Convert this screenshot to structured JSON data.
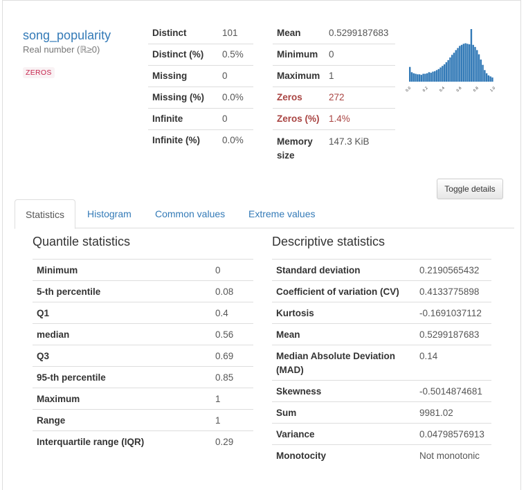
{
  "variable": {
    "name": "song_popularity",
    "type": "Real number (ℝ≥0)",
    "badge": "ZEROS"
  },
  "overview_left": [
    {
      "label": "Distinct",
      "value": "101"
    },
    {
      "label": "Distinct (%)",
      "value": "0.5%"
    },
    {
      "label": "Missing",
      "value": "0"
    },
    {
      "label": "Missing (%)",
      "value": "0.0%"
    },
    {
      "label": "Infinite",
      "value": "0"
    },
    {
      "label": "Infinite (%)",
      "value": "0.0%"
    }
  ],
  "overview_right": [
    {
      "label": "Mean",
      "value": "0.5299187683"
    },
    {
      "label": "Minimum",
      "value": "0"
    },
    {
      "label": "Maximum",
      "value": "1"
    },
    {
      "label": "Zeros",
      "value": "272"
    },
    {
      "label": "Zeros (%)",
      "value": "1.4%"
    },
    {
      "label": "Memory size",
      "value": "147.3 KiB"
    }
  ],
  "histogram": {
    "tick_labels": [
      "0.0",
      "0.2",
      "0.4",
      "0.6",
      "0.8",
      "1.0"
    ],
    "bar_color": "#337ab7",
    "relative_heights": [
      0.28,
      0.18,
      0.16,
      0.15,
      0.14,
      0.14,
      0.13,
      0.15,
      0.15,
      0.16,
      0.18,
      0.17,
      0.19,
      0.2,
      0.22,
      0.24,
      0.27,
      0.3,
      0.33,
      0.37,
      0.41,
      0.46,
      0.51,
      0.55,
      0.6,
      0.64,
      0.68,
      0.7,
      0.72,
      0.73,
      0.72,
      0.71,
      1.0,
      0.7,
      0.66,
      0.6,
      0.52,
      0.42,
      0.32,
      0.22,
      0.16,
      0.12,
      0.1,
      0.08
    ]
  },
  "toggle_button": "Toggle details",
  "tabs": [
    "Statistics",
    "Histogram",
    "Common values",
    "Extreme values"
  ],
  "quantile": {
    "title": "Quantile statistics",
    "rows": [
      {
        "label": "Minimum",
        "value": "0"
      },
      {
        "label": "5-th percentile",
        "value": "0.08"
      },
      {
        "label": "Q1",
        "value": "0.4"
      },
      {
        "label": "median",
        "value": "0.56"
      },
      {
        "label": "Q3",
        "value": "0.69"
      },
      {
        "label": "95-th percentile",
        "value": "0.85"
      },
      {
        "label": "Maximum",
        "value": "1"
      },
      {
        "label": "Range",
        "value": "1"
      },
      {
        "label": "Interquartile range (IQR)",
        "value": "0.29"
      }
    ]
  },
  "descriptive": {
    "title": "Descriptive statistics",
    "rows": [
      {
        "label": "Standard deviation",
        "value": "0.2190565432"
      },
      {
        "label": "Coefficient of variation (CV)",
        "value": "0.4133775898"
      },
      {
        "label": "Kurtosis",
        "value": "-0.1691037112"
      },
      {
        "label": "Mean",
        "value": "0.5299187683"
      },
      {
        "label": "Median Absolute Deviation (MAD)",
        "value": "0.14"
      },
      {
        "label": "Skewness",
        "value": "-0.5014874681"
      },
      {
        "label": "Sum",
        "value": "9981.02"
      },
      {
        "label": "Variance",
        "value": "0.04798576913"
      },
      {
        "label": "Monotocity",
        "value": "Not monotonic"
      }
    ]
  },
  "colors": {
    "link": "#337ab7",
    "alert": "#a94442",
    "badge_text": "#c7254e"
  }
}
